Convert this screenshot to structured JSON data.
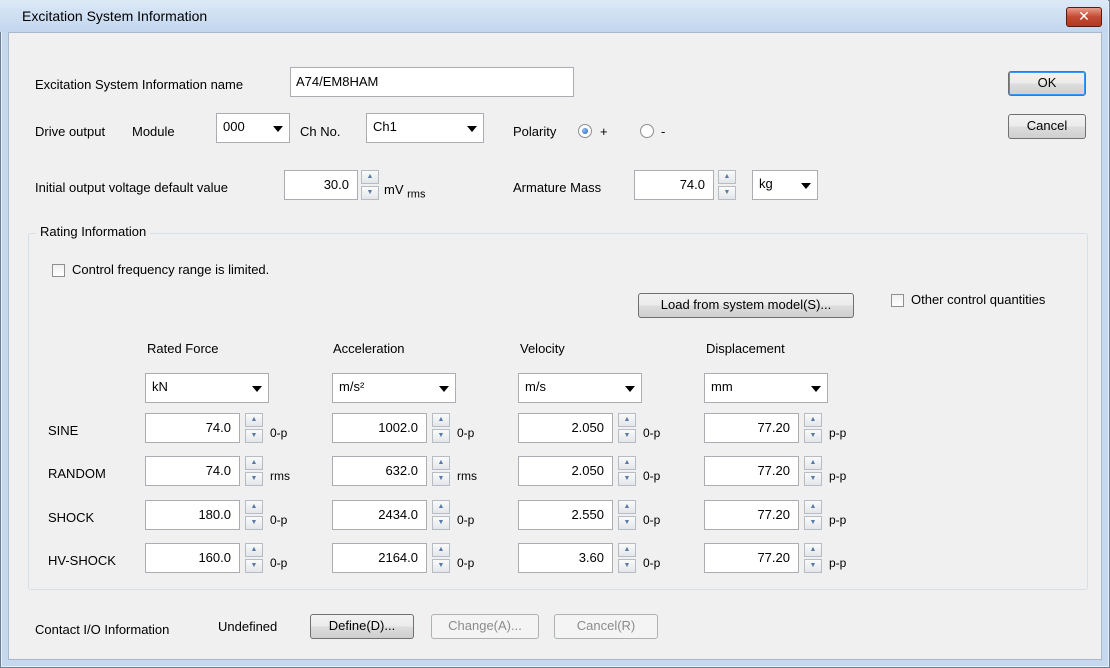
{
  "window": {
    "title": "Excitation System Information",
    "close_symbol": "✕"
  },
  "name_field": {
    "label": "Excitation System Information name",
    "value": "A74/EM8HAM"
  },
  "buttons": {
    "ok": "OK",
    "cancel": "Cancel"
  },
  "drive_output": {
    "label": "Drive output",
    "module_label": "Module",
    "module_value": "000",
    "ch_label": "Ch No.",
    "ch_value": "Ch1",
    "polarity_label": "Polarity",
    "polarity_plus": "+",
    "polarity_minus": "-",
    "polarity_selected": "+"
  },
  "initial_voltage": {
    "label": "Initial output voltage default value",
    "value": "30.0",
    "unit": "mV",
    "unit_sub": "rms"
  },
  "armature_mass": {
    "label": "Armature Mass",
    "value": "74.0",
    "unit": "kg"
  },
  "rating": {
    "title": "Rating Information",
    "control_limited": "Control frequency range is limited.",
    "load_button": "Load from system model(S)...",
    "other_quantities": "Other control quantities",
    "columns": [
      {
        "header": "Rated Force",
        "unit": "kN"
      },
      {
        "header": "Acceleration",
        "unit": "m/s²"
      },
      {
        "header": "Velocity",
        "unit": "m/s"
      },
      {
        "header": "Displacement",
        "unit": "mm"
      }
    ],
    "rows": [
      {
        "label": "SINE",
        "values": [
          "74.0",
          "1002.0",
          "2.050",
          "77.20"
        ],
        "suffixes": [
          "0-p",
          "0-p",
          "0-p",
          "p-p"
        ]
      },
      {
        "label": "RANDOM",
        "values": [
          "74.0",
          "632.0",
          "2.050",
          "77.20"
        ],
        "suffixes": [
          "rms",
          "rms",
          "0-p",
          "p-p"
        ]
      },
      {
        "label": "SHOCK",
        "values": [
          "180.0",
          "2434.0",
          "2.550",
          "77.20"
        ],
        "suffixes": [
          "0-p",
          "0-p",
          "0-p",
          "p-p"
        ]
      },
      {
        "label": "HV-SHOCK",
        "values": [
          "160.0",
          "2164.0",
          "3.60",
          "77.20"
        ],
        "suffixes": [
          "0-p",
          "0-p",
          "0-p",
          "p-p"
        ]
      }
    ]
  },
  "contact_io": {
    "label": "Contact I/O Information",
    "status": "Undefined",
    "define": "Define(D)...",
    "change": "Change(A)...",
    "cancel": "Cancel(R)"
  },
  "colors": {
    "titlebar": "#c5d8ee",
    "client": "#f0f0f0",
    "close_button": "#c44a33"
  }
}
